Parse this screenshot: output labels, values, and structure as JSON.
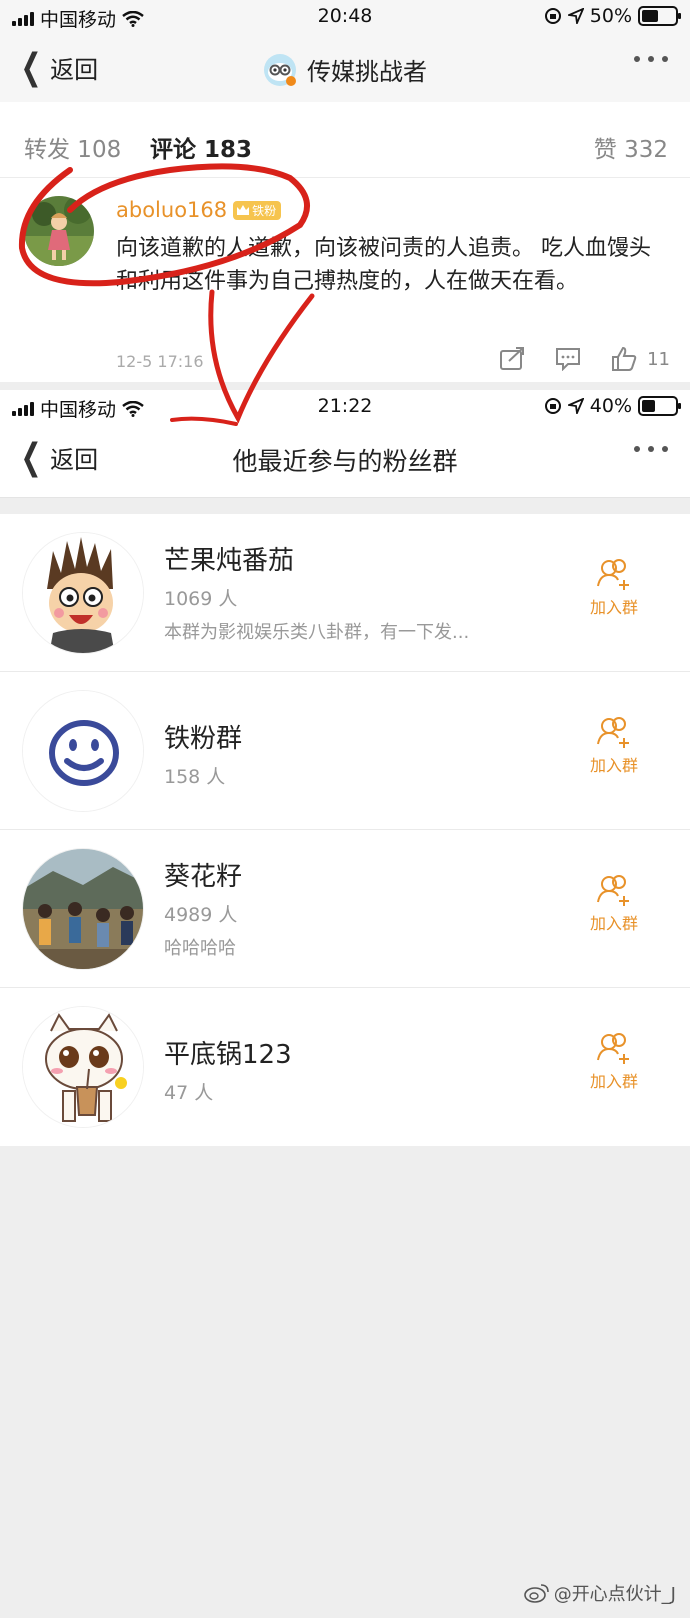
{
  "top_screen": {
    "status": {
      "carrier": "中国移动",
      "time": "20:48",
      "battery": "50%",
      "battery_level": 0.5
    },
    "nav": {
      "back": "返回",
      "title": "传媒挑战者"
    },
    "tabs": {
      "repost": "转发 108",
      "comment": "评论 183",
      "like": "赞 332"
    },
    "comment": {
      "username": "aboluo168",
      "badge": "铁粉",
      "text": "向该道歉的人道歉，向该被问责的人追责。 吃人血馒头和利用这件事为自己搏热度的，人在做天在看。",
      "date": "12-5 17:16",
      "likes": "11"
    }
  },
  "bottom_screen": {
    "status": {
      "carrier": "中国移动",
      "time": "21:22",
      "battery": "40%",
      "battery_level": 0.4
    },
    "nav": {
      "back": "返回",
      "title": "他最近参与的粉丝群"
    },
    "groups": [
      {
        "name": "芒果炖番茄",
        "count": "1069 人",
        "desc": "本群为影视娱乐类八卦群，有一下发...",
        "join": "加入群"
      },
      {
        "name": "铁粉群",
        "count": "158 人",
        "desc": "",
        "join": "加入群"
      },
      {
        "name": "葵花籽",
        "count": "4989 人",
        "desc": "哈哈哈哈",
        "join": "加入群"
      },
      {
        "name": "平底锅123",
        "count": "47 人",
        "desc": "",
        "join": "加入群"
      }
    ]
  },
  "watermark": "@开心点伙计_J",
  "colors": {
    "accent": "#e8922a",
    "annotation": "#d8221a"
  }
}
